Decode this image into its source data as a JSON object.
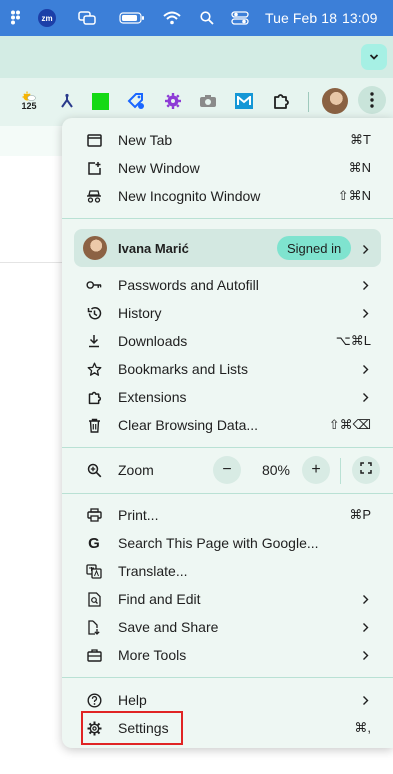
{
  "menubar": {
    "date": "Tue Feb 18",
    "time": "13:09",
    "zoom_app_label": "zm"
  },
  "toolbar": {
    "weather_badge": "125"
  },
  "menu": {
    "group1": [
      {
        "label": "New Tab",
        "shortcut": "⌘T",
        "icon": "new-tab-icon"
      },
      {
        "label": "New Window",
        "shortcut": "⌘N",
        "icon": "new-window-icon"
      },
      {
        "label": "New Incognito Window",
        "shortcut": "⇧⌘N",
        "icon": "incognito-icon"
      }
    ],
    "profile": {
      "name": "Ivana Marić",
      "status": "Signed in"
    },
    "group2": [
      {
        "label": "Passwords and Autofill",
        "icon": "key-icon",
        "submenu": true
      },
      {
        "label": "History",
        "icon": "history-icon",
        "submenu": true
      },
      {
        "label": "Downloads",
        "shortcut": "⌥⌘L",
        "icon": "download-icon"
      },
      {
        "label": "Bookmarks and Lists",
        "icon": "star-icon",
        "submenu": true
      },
      {
        "label": "Extensions",
        "icon": "puzzle-icon",
        "submenu": true
      },
      {
        "label": "Clear Browsing Data...",
        "shortcut": "⇧⌘⌫",
        "icon": "trash-icon"
      }
    ],
    "zoom": {
      "label": "Zoom",
      "value": "80%",
      "minus": "−",
      "plus": "+"
    },
    "group3": [
      {
        "label": "Print...",
        "shortcut": "⌘P",
        "icon": "print-icon"
      },
      {
        "label": "Search This Page with Google...",
        "icon": "google-icon"
      },
      {
        "label": "Translate...",
        "icon": "translate-icon"
      },
      {
        "label": "Find and Edit",
        "icon": "find-icon",
        "submenu": true
      },
      {
        "label": "Save and Share",
        "icon": "save-share-icon",
        "submenu": true
      },
      {
        "label": "More Tools",
        "icon": "toolbox-icon",
        "submenu": true
      }
    ],
    "group4": [
      {
        "label": "Help",
        "icon": "help-icon",
        "submenu": true
      },
      {
        "label": "Settings",
        "shortcut": "⌘,",
        "icon": "gear-icon"
      }
    ]
  },
  "colors": {
    "menubar": "#3c7fd8",
    "tabstrip": "#d3ece4",
    "menu_bg": "#eef7f3",
    "signed_in_badge": "#7fe3cf",
    "highlight": "#e02424"
  }
}
